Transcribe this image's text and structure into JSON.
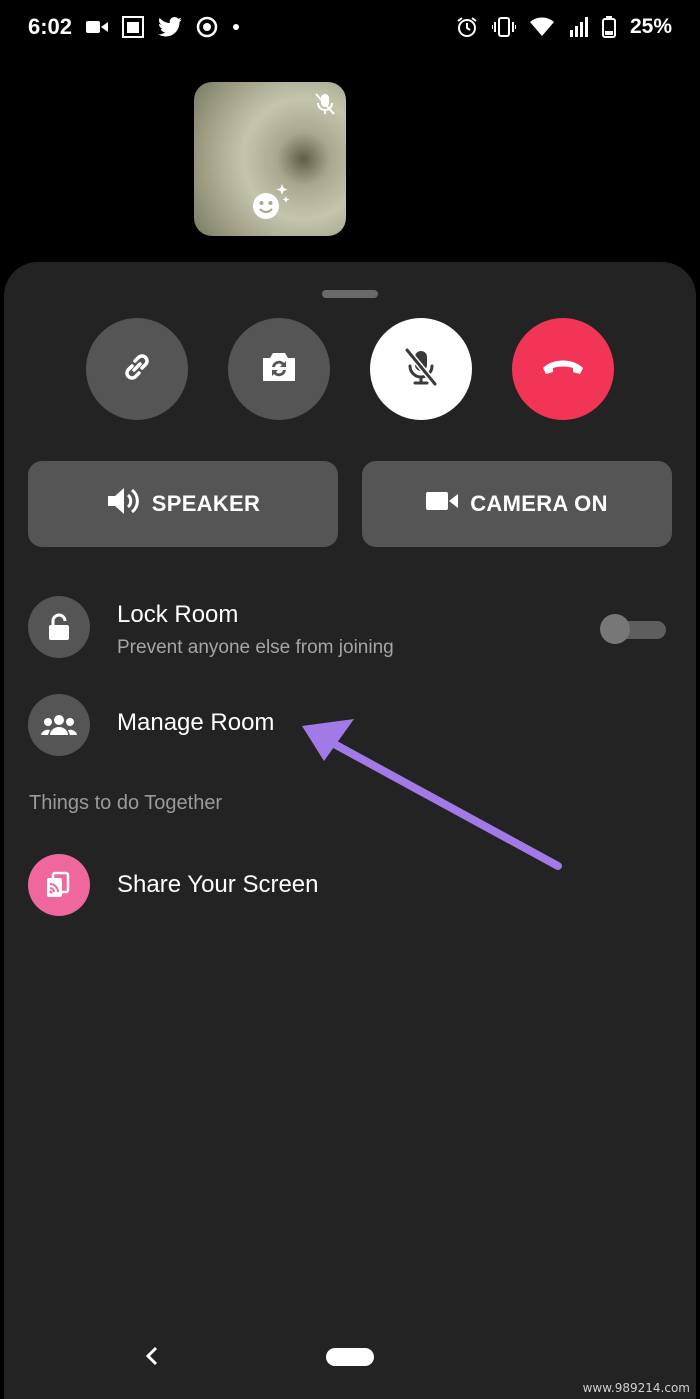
{
  "status_bar": {
    "time": "6:02",
    "battery_percent": "25%",
    "left_icons": [
      "video-icon",
      "photo-icon",
      "twitter-icon",
      "sync-icon",
      "dot-icon"
    ],
    "right_icons": [
      "alarm-icon",
      "vibrate-icon",
      "wifi-icon",
      "signal-icon",
      "battery-icon"
    ]
  },
  "call": {
    "controls": [
      {
        "name": "link-icon"
      },
      {
        "name": "flip-camera-icon"
      },
      {
        "name": "mic-off-icon",
        "active": true
      },
      {
        "name": "end-call-icon",
        "color": "#f23456"
      }
    ],
    "speaker_label": "SPEAKER",
    "camera_label": "CAMERA ON"
  },
  "options": {
    "lock_room": {
      "title": "Lock Room",
      "subtitle": "Prevent anyone else from joining",
      "enabled": false
    },
    "manage_room": {
      "title": "Manage Room"
    },
    "section_title": "Things to do Together",
    "share_screen": {
      "title": "Share Your Screen",
      "color": "#f0679e"
    }
  },
  "annotation": {
    "arrow_color": "#a27ae8"
  },
  "watermark": "www.989214.com",
  "colors": {
    "sheet": "#232323",
    "button": "#555555",
    "end_call": "#f23456"
  }
}
